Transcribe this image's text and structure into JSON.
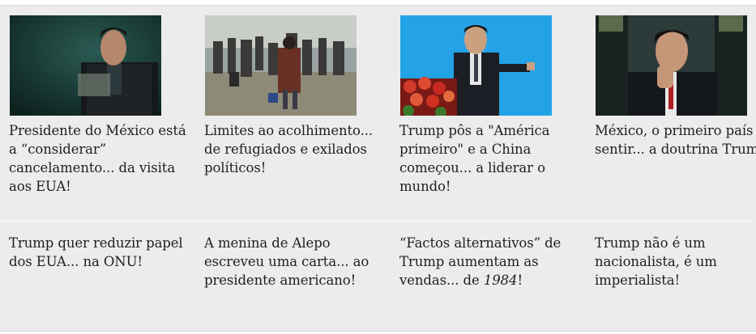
{
  "articles_top": [
    {
      "headline": "Presidente do México está a “considerar” cancelamento... da visita aos EUA!",
      "image": "man-in-suit-dark-background"
    },
    {
      "headline": "Limites ao acolhimento... de refugiados e exilados políticos!",
      "image": "refugees-walking-crowd"
    },
    {
      "headline": "Trump pôs a \"América primeiro\" e a China começou... a liderar o mundo!",
      "image": "leader-pointing-blue-background"
    },
    {
      "headline": "México, o primeiro país a sentir... a doutrina Trump!",
      "image": "man-hand-on-chin-military"
    }
  ],
  "articles_bottom": [
    {
      "headline": "Trump quer reduzir papel dos EUA... na ONU!"
    },
    {
      "headline": "A menina de Alepo escreveu uma carta... ao presidente americano!"
    },
    {
      "headline_prefix": "“Factos alternativos” de Trump aumentam as vendas... de ",
      "headline_italic": "1984",
      "headline_suffix": "!"
    },
    {
      "headline": "Trump não é um nacionalista, é um imperialista!"
    }
  ]
}
